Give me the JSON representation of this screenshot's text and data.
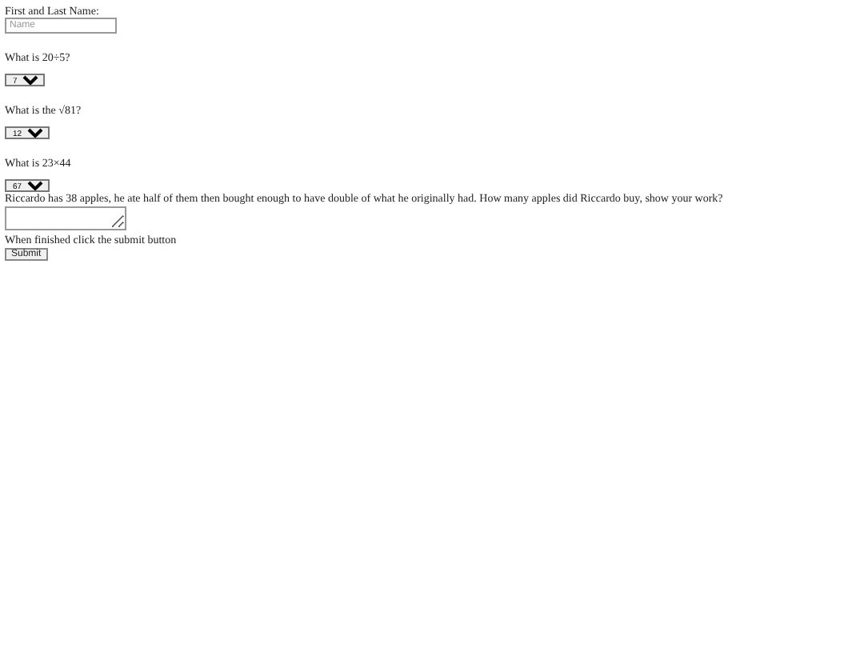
{
  "name_field": {
    "label": "First and Last Name:",
    "placeholder": "Name"
  },
  "questions": [
    {
      "kind": "select",
      "text": "What is 20÷5?",
      "value": "7"
    },
    {
      "kind": "select",
      "text": "What is the √81?",
      "value": "12"
    },
    {
      "kind": "select",
      "text": "What is 23×44",
      "value": "67"
    },
    {
      "kind": "text",
      "text": "Riccardo has 38 apples, he ate half of them then bought enough to have double of what he originally had. How many apples did Riccardo buy, show your work?"
    }
  ],
  "footer": {
    "text": "When finished click the submit button",
    "button": "Submit"
  }
}
